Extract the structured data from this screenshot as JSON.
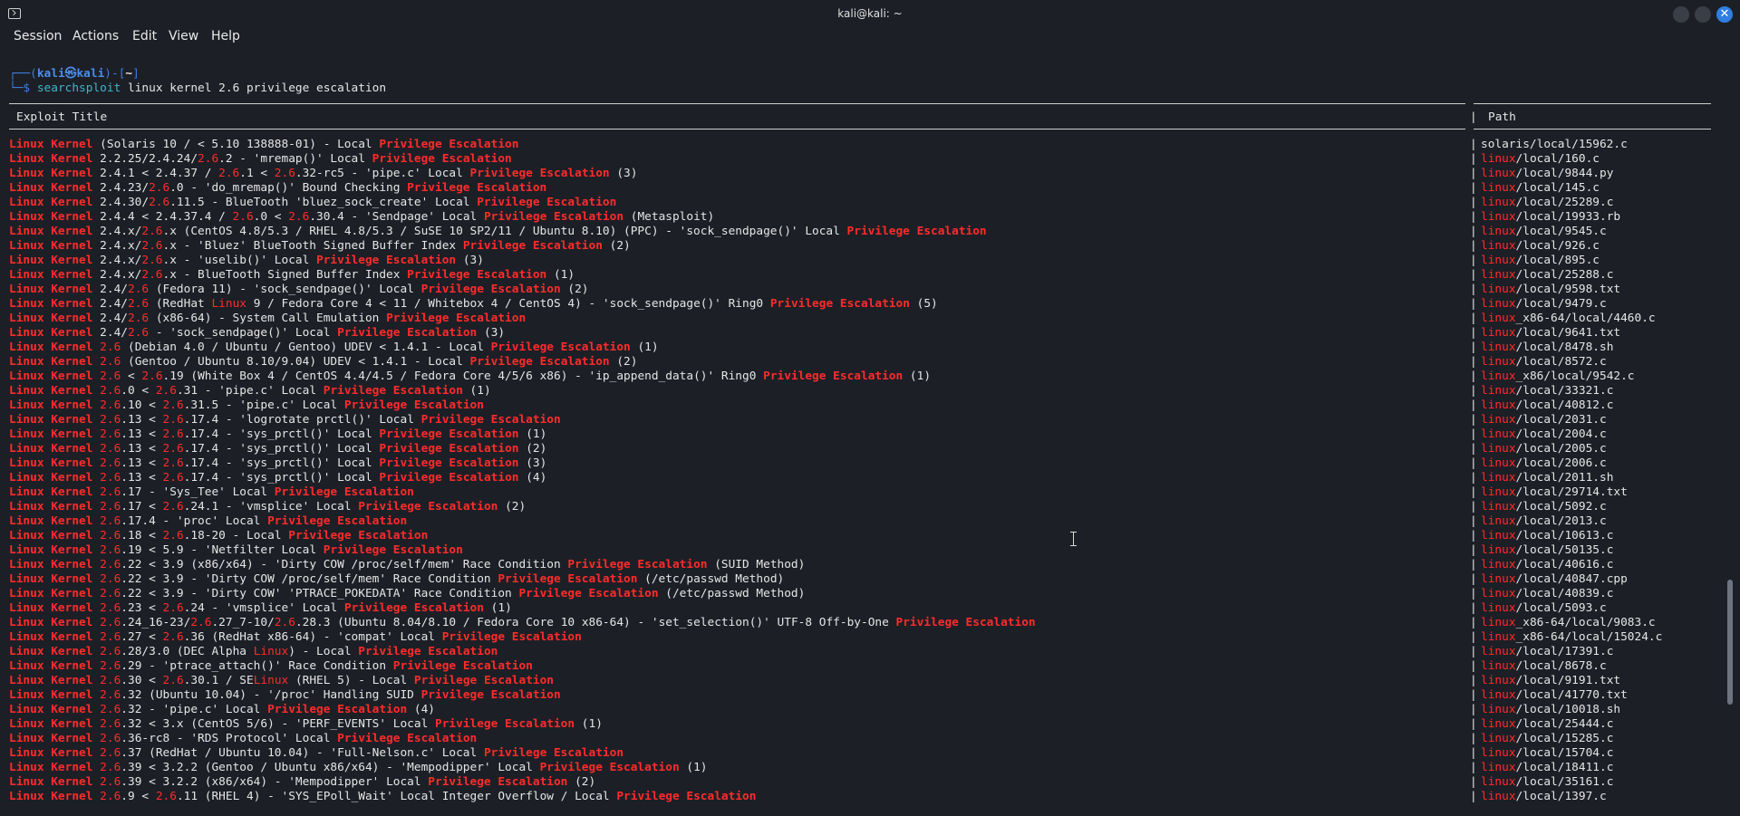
{
  "window": {
    "title": "kali@kali: ~"
  },
  "menu": [
    "Session",
    "Actions",
    "Edit",
    "View",
    "Help"
  ],
  "prompt": {
    "user": "kali",
    "at": "㉿",
    "host": "kali",
    "dir": "~",
    "command": "searchsploit",
    "args": "linux kernel 2.6 privilege escalation"
  },
  "table": {
    "col_title": "Exploit Title",
    "col_path": "Path",
    "rows": [
      {
        "t": "Linux Kernel (Solaris 10 / < 5.10 138888-01) - Local Privilege Escalation",
        "p": "solaris/local/15962.c"
      },
      {
        "t": "Linux Kernel 2.2.25/2.4.24/2.6.2 - 'mremap()' Local Privilege Escalation",
        "p": "linux/local/160.c"
      },
      {
        "t": "Linux Kernel 2.4.1 < 2.4.37 / 2.6.1 < 2.6.32-rc5 - 'pipe.c' Local Privilege Escalation (3)",
        "p": "linux/local/9844.py"
      },
      {
        "t": "Linux Kernel 2.4.23/2.6.0 - 'do_mremap()' Bound Checking Privilege Escalation",
        "p": "linux/local/145.c"
      },
      {
        "t": "Linux Kernel 2.4.30/2.6.11.5 - BlueTooth 'bluez_sock_create' Local Privilege Escalation",
        "p": "linux/local/25289.c"
      },
      {
        "t": "Linux Kernel 2.4.4 < 2.4.37.4 / 2.6.0 < 2.6.30.4 - 'Sendpage' Local Privilege Escalation (Metasploit)",
        "p": "linux/local/19933.rb"
      },
      {
        "t": "Linux Kernel 2.4.x/2.6.x (CentOS 4.8/5.3 / RHEL 4.8/5.3 / SuSE 10 SP2/11 / Ubuntu 8.10) (PPC) - 'sock_sendpage()' Local Privilege Escalation",
        "p": "linux/local/9545.c"
      },
      {
        "t": "Linux Kernel 2.4.x/2.6.x - 'Bluez' BlueTooth Signed Buffer Index Privilege Escalation (2)",
        "p": "linux/local/926.c"
      },
      {
        "t": "Linux Kernel 2.4.x/2.6.x - 'uselib()' Local Privilege Escalation (3)",
        "p": "linux/local/895.c"
      },
      {
        "t": "Linux Kernel 2.4.x/2.6.x - BlueTooth Signed Buffer Index Privilege Escalation (1)",
        "p": "linux/local/25288.c"
      },
      {
        "t": "Linux Kernel 2.4/2.6 (Fedora 11) - 'sock_sendpage()' Local Privilege Escalation (2)",
        "p": "linux/local/9598.txt"
      },
      {
        "t": "Linux Kernel 2.4/2.6 (RedHat Linux 9 / Fedora Core 4 < 11 / Whitebox 4 / CentOS 4) - 'sock_sendpage()' Ring0 Privilege Escalation (5)",
        "p": "linux/local/9479.c"
      },
      {
        "t": "Linux Kernel 2.4/2.6 (x86-64) - System Call Emulation Privilege Escalation",
        "p": "linux_x86-64/local/4460.c"
      },
      {
        "t": "Linux Kernel 2.4/2.6 - 'sock_sendpage()' Local Privilege Escalation (3)",
        "p": "linux/local/9641.txt"
      },
      {
        "t": "Linux Kernel 2.6 (Debian 4.0 / Ubuntu / Gentoo) UDEV < 1.4.1 - Local Privilege Escalation (1)",
        "p": "linux/local/8478.sh"
      },
      {
        "t": "Linux Kernel 2.6 (Gentoo / Ubuntu 8.10/9.04) UDEV < 1.4.1 - Local Privilege Escalation (2)",
        "p": "linux/local/8572.c"
      },
      {
        "t": "Linux Kernel 2.6 < 2.6.19 (White Box 4 / CentOS 4.4/4.5 / Fedora Core 4/5/6 x86) - 'ip_append_data()' Ring0 Privilege Escalation (1)",
        "p": "linux_x86/local/9542.c"
      },
      {
        "t": "Linux Kernel 2.6.0 < 2.6.31 - 'pipe.c' Local Privilege Escalation (1)",
        "p": "linux/local/33321.c"
      },
      {
        "t": "Linux Kernel 2.6.10 < 2.6.31.5 - 'pipe.c' Local Privilege Escalation",
        "p": "linux/local/40812.c"
      },
      {
        "t": "Linux Kernel 2.6.13 < 2.6.17.4 - 'logrotate prctl()' Local Privilege Escalation",
        "p": "linux/local/2031.c"
      },
      {
        "t": "Linux Kernel 2.6.13 < 2.6.17.4 - 'sys_prctl()' Local Privilege Escalation (1)",
        "p": "linux/local/2004.c"
      },
      {
        "t": "Linux Kernel 2.6.13 < 2.6.17.4 - 'sys_prctl()' Local Privilege Escalation (2)",
        "p": "linux/local/2005.c"
      },
      {
        "t": "Linux Kernel 2.6.13 < 2.6.17.4 - 'sys_prctl()' Local Privilege Escalation (3)",
        "p": "linux/local/2006.c"
      },
      {
        "t": "Linux Kernel 2.6.13 < 2.6.17.4 - 'sys_prctl()' Local Privilege Escalation (4)",
        "p": "linux/local/2011.sh"
      },
      {
        "t": "Linux Kernel 2.6.17 - 'Sys_Tee' Local Privilege Escalation",
        "p": "linux/local/29714.txt"
      },
      {
        "t": "Linux Kernel 2.6.17 < 2.6.24.1 - 'vmsplice' Local Privilege Escalation (2)",
        "p": "linux/local/5092.c"
      },
      {
        "t": "Linux Kernel 2.6.17.4 - 'proc' Local Privilege Escalation",
        "p": "linux/local/2013.c"
      },
      {
        "t": "Linux Kernel 2.6.18 < 2.6.18-20 - Local Privilege Escalation",
        "p": "linux/local/10613.c"
      },
      {
        "t": "Linux Kernel 2.6.19 < 5.9 - 'Netfilter Local Privilege Escalation",
        "p": "linux/local/50135.c"
      },
      {
        "t": "Linux Kernel 2.6.22 < 3.9 (x86/x64) - 'Dirty COW /proc/self/mem' Race Condition Privilege Escalation (SUID Method)",
        "p": "linux/local/40616.c"
      },
      {
        "t": "Linux Kernel 2.6.22 < 3.9 - 'Dirty COW /proc/self/mem' Race Condition Privilege Escalation (/etc/passwd Method)",
        "p": "linux/local/40847.cpp"
      },
      {
        "t": "Linux Kernel 2.6.22 < 3.9 - 'Dirty COW' 'PTRACE_POKEDATA' Race Condition Privilege Escalation (/etc/passwd Method)",
        "p": "linux/local/40839.c"
      },
      {
        "t": "Linux Kernel 2.6.23 < 2.6.24 - 'vmsplice' Local Privilege Escalation (1)",
        "p": "linux/local/5093.c"
      },
      {
        "t": "Linux Kernel 2.6.24_16-23/2.6.27_7-10/2.6.28.3 (Ubuntu 8.04/8.10 / Fedora Core 10 x86-64) - 'set_selection()' UTF-8 Off-by-One Privilege Escalation",
        "p": "linux_x86-64/local/9083.c"
      },
      {
        "t": "Linux Kernel 2.6.27 < 2.6.36 (RedHat x86-64) - 'compat' Local Privilege Escalation",
        "p": "linux_x86-64/local/15024.c"
      },
      {
        "t": "Linux Kernel 2.6.28/3.0 (DEC Alpha Linux) - Local Privilege Escalation",
        "p": "linux/local/17391.c"
      },
      {
        "t": "Linux Kernel 2.6.29 - 'ptrace_attach()' Race Condition Privilege Escalation",
        "p": "linux/local/8678.c"
      },
      {
        "t": "Linux Kernel 2.6.30 < 2.6.30.1 / SELinux (RHEL 5) - Local Privilege Escalation",
        "p": "linux/local/9191.txt"
      },
      {
        "t": "Linux Kernel 2.6.32 (Ubuntu 10.04) - '/proc' Handling SUID Privilege Escalation",
        "p": "linux/local/41770.txt"
      },
      {
        "t": "Linux Kernel 2.6.32 - 'pipe.c' Local Privilege Escalation (4)",
        "p": "linux/local/10018.sh"
      },
      {
        "t": "Linux Kernel 2.6.32 < 3.x (CentOS 5/6) - 'PERF_EVENTS' Local Privilege Escalation (1)",
        "p": "linux/local/25444.c"
      },
      {
        "t": "Linux Kernel 2.6.36-rc8 - 'RDS Protocol' Local Privilege Escalation",
        "p": "linux/local/15285.c"
      },
      {
        "t": "Linux Kernel 2.6.37 (RedHat / Ubuntu 10.04) - 'Full-Nelson.c' Local Privilege Escalation",
        "p": "linux/local/15704.c"
      },
      {
        "t": "Linux Kernel 2.6.39 < 3.2.2 (Gentoo / Ubuntu x86/x64) - 'Mempodipper' Local Privilege Escalation (1)",
        "p": "linux/local/18411.c"
      },
      {
        "t": "Linux Kernel 2.6.39 < 3.2.2 (x86/x64) - 'Mempodipper' Local Privilege Escalation (2)",
        "p": "linux/local/35161.c"
      },
      {
        "t": "Linux Kernel 2.6.9 < 2.6.11 (RHEL 4) - 'SYS_EPoll_Wait' Local Integer Overflow / Local Privilege Escalation",
        "p": "linux/local/1397.c"
      }
    ]
  },
  "colors": {
    "highlight": "#ff2b2b",
    "prompt": "#3a7fe0",
    "background": "#1c1f26"
  }
}
